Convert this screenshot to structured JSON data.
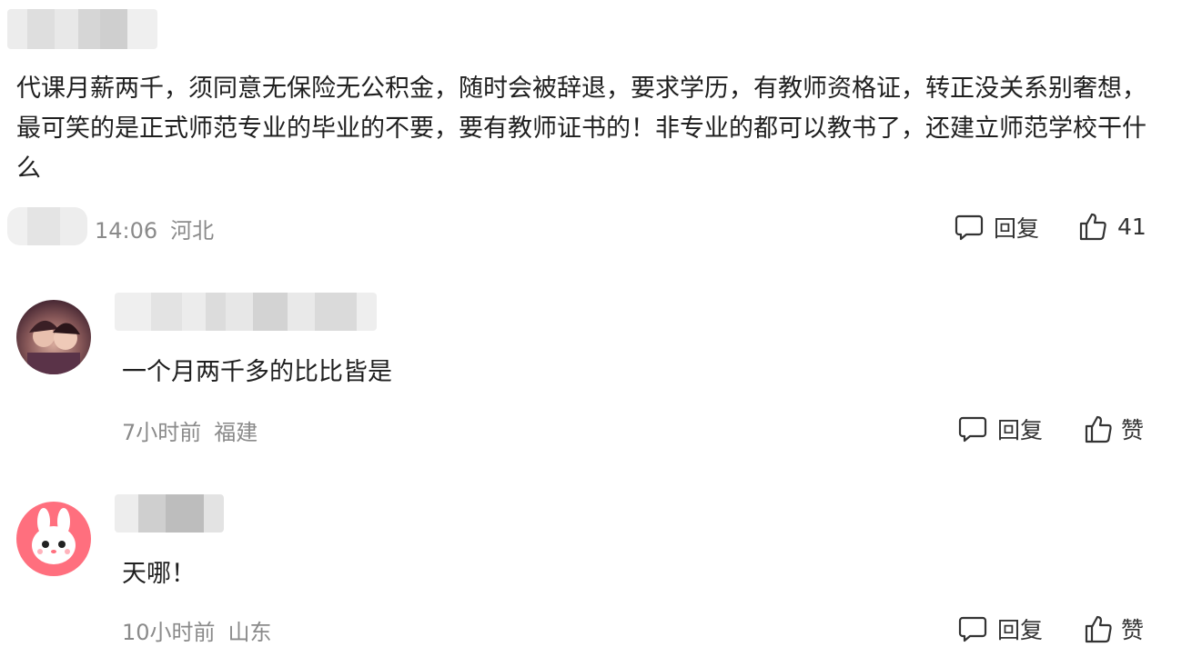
{
  "top_comment": {
    "text": "代课月薪两千，须同意无保险无公积金，随时会被辞退，要求学历，有教师资格证，转正没关系别奢想，最可笑的是正式师范专业的毕业的不要，要有教师证书的！非专业的都可以教书了，还建立师范学校干什么",
    "time": "14:06",
    "location": "河北",
    "reply_label": "回复",
    "like_count": "41"
  },
  "replies": [
    {
      "text": "一个月两千多的比比皆是",
      "time": "7小时前",
      "location": "福建",
      "reply_label": "回复",
      "like_label": "赞"
    },
    {
      "text": "天哪！",
      "time": "10小时前",
      "location": "山东",
      "reply_label": "回复",
      "like_label": "赞"
    }
  ]
}
